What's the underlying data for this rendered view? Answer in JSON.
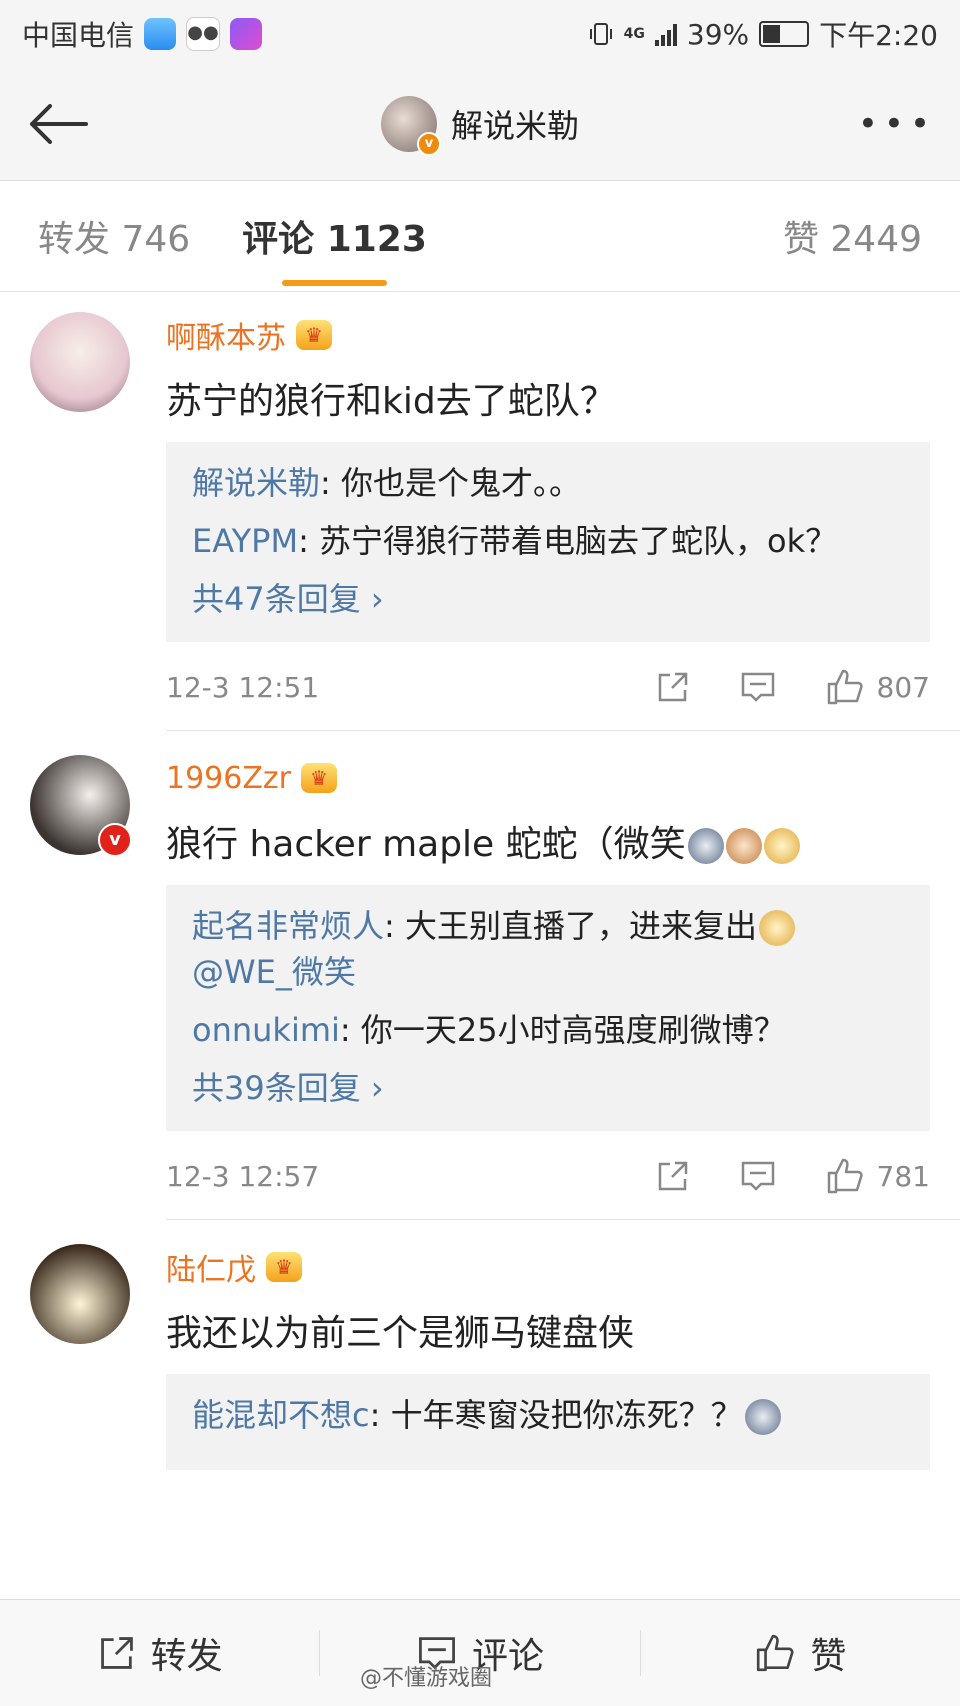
{
  "statusbar": {
    "carrier": "中国电信",
    "network": "4G",
    "battery": "39%",
    "time": "下午2:20",
    "battery_level": 0.39
  },
  "header": {
    "back_icon": "arrow-left-icon",
    "title": "解说米勒",
    "more_label": "•••"
  },
  "tabs": [
    {
      "label": "转发 746"
    },
    {
      "label": "评论 1123"
    },
    {
      "label": "赞 2449"
    }
  ],
  "comments": [
    {
      "user": "啊酥本苏",
      "text": "苏宁的狼行和kid去了蛇队？",
      "replies": [
        {
          "user": "解说米勒",
          "text": ": 你也是个鬼才。。"
        },
        {
          "user": "EAYPM",
          "text": ": 苏宁得狼行带着电脑去了蛇队，ok？"
        }
      ],
      "more": "共47条回复 ›",
      "time": "12-3 12:51",
      "likes": "807"
    },
    {
      "user": "1996Zzr",
      "text": "狼行 hacker maple 蛇蛇（微笑",
      "replies": [
        {
          "user": "起名非常烦人",
          "text": ": 大王别直播了，进来复出"
        },
        {
          "user": "",
          "text": "@WE_微笑"
        },
        {
          "user": "onnukimi",
          "text": ": 你一天25小时高强度刷微博？"
        }
      ],
      "more": "共39条回复 ›",
      "time": "12-3 12:57",
      "likes": "781"
    },
    {
      "user": "陆仁戊",
      "text": "我还以为前三个是狮马键盘侠",
      "replies": [
        {
          "user": "能混却不想c",
          "text": ": 十年寒窗没把你冻死？？"
        }
      ]
    }
  ],
  "bottombar": {
    "repost": "转发",
    "comment": "评论",
    "like": "赞"
  },
  "watermark": "@不懂游戏圈",
  "colors": {
    "accent": "#f59b16",
    "username": "#eb7321",
    "link": "#4e78a6"
  }
}
